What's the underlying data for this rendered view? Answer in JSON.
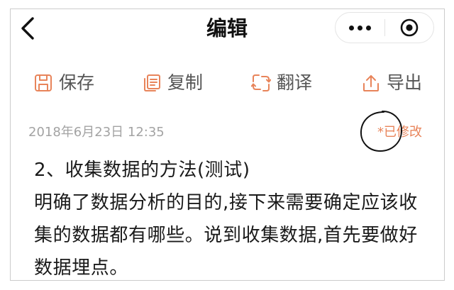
{
  "nav": {
    "title": "编辑",
    "back_icon": "chevron-left-icon",
    "more_icon": "more-dots-icon",
    "close_icon": "target-icon"
  },
  "toolbar": {
    "items": [
      {
        "label": "保存",
        "icon": "save-icon"
      },
      {
        "label": "复制",
        "icon": "copy-icon"
      },
      {
        "label": "翻译",
        "icon": "translate-icon"
      },
      {
        "label": "导出",
        "icon": "export-icon"
      }
    ]
  },
  "meta": {
    "timestamp": "2018年6月23日 12:35",
    "status": "*已修改"
  },
  "content": {
    "heading": "2、收集数据的方法(测试)",
    "lines": [
      "明确了数据分析的目的,接下来需要确定应该收",
      "集的数据都有哪些。说到收集数据,首先要做好",
      "数据埋点。"
    ]
  },
  "colors": {
    "accent": "#e8845a",
    "text": "#1a1a1a",
    "label": "#555555",
    "muted": "#a3a3a3",
    "title": "#111111",
    "annotation": "#111111"
  }
}
